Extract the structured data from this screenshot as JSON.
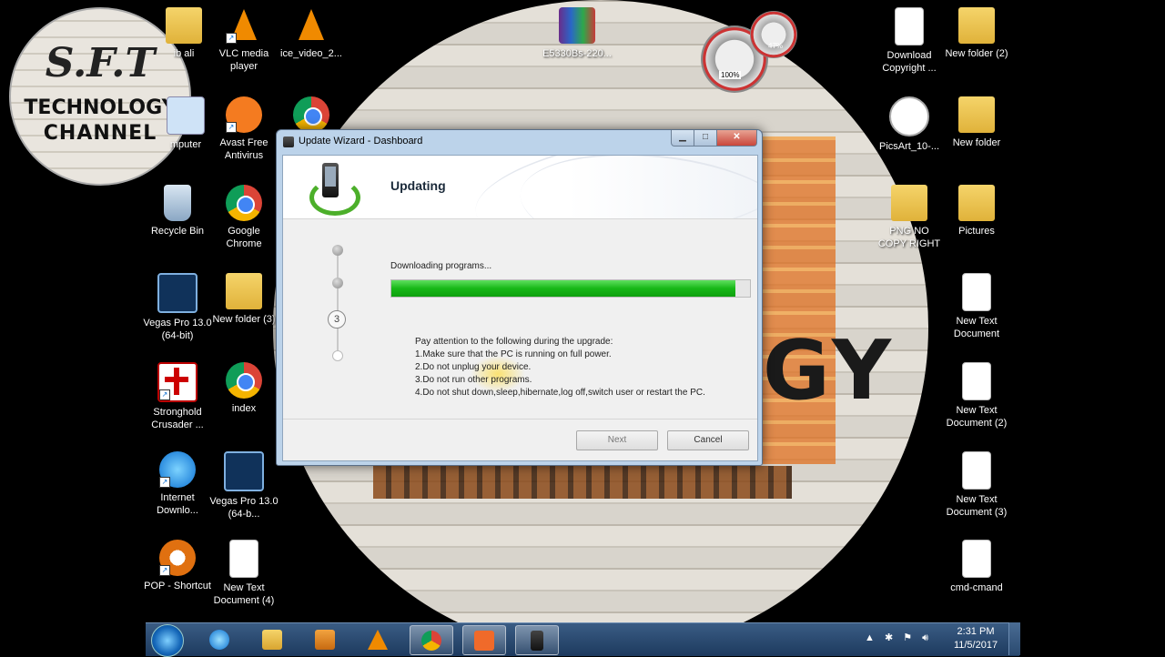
{
  "logo": {
    "top": "S.F.T",
    "mid": "TECHNOLOGY",
    "bottom": "CHANNEL"
  },
  "gauge": {
    "cpu": "100%",
    "mem": "47%"
  },
  "desktop_icons": {
    "ib_ali": "ib ali",
    "vlc": "VLC media player",
    "ice_video": "ice_video_2...",
    "rar": "E5330Bs-220...",
    "computer": "mputer",
    "avast": "Avast Free Antivirus",
    "recycle": "Recycle Bin",
    "chrome": "Google Chrome",
    "vegas1": "Vegas Pro 13.0 (64-bit)",
    "newfolder3": "New folder (3)",
    "stronghold": "Stronghold Crusader ...",
    "index": "index",
    "idm": "Internet Downlo...",
    "vegas2": "Vegas Pro 13.0 (64-b...",
    "pop": "POP - Shortcut",
    "newtext4": "New Text Document (4)",
    "download": "Download Copyright ...",
    "newfolder2": "New folder (2)",
    "picsart": "PicsArt_10-...",
    "newfolder": "New folder",
    "png": "PNG NO COPY RIGHT",
    "pictures": "Pictures",
    "newtext": "New Text Document",
    "newtext2": "New Text Document (2)",
    "newtext3": "New Text Document (3)",
    "cmd": "cmd-cmand"
  },
  "dialog": {
    "title": "Update Wizard - Dashboard",
    "header_title": "Updating",
    "current_step": "3",
    "progress_label": "Downloading programs...",
    "progress_fraction": 0.96,
    "notes": [
      "Pay attention to the following during the upgrade:",
      "1.Make sure that the PC is running on full power.",
      "2.Do not unplug your device.",
      "3.Do not run other programs.",
      "4.Do not shut down,sleep,hibernate,log off,switch user or restart the PC."
    ],
    "next_label": "Next",
    "cancel_label": "Cancel"
  },
  "taskbar": {
    "time": "2:31 PM",
    "date": "11/5/2017"
  }
}
